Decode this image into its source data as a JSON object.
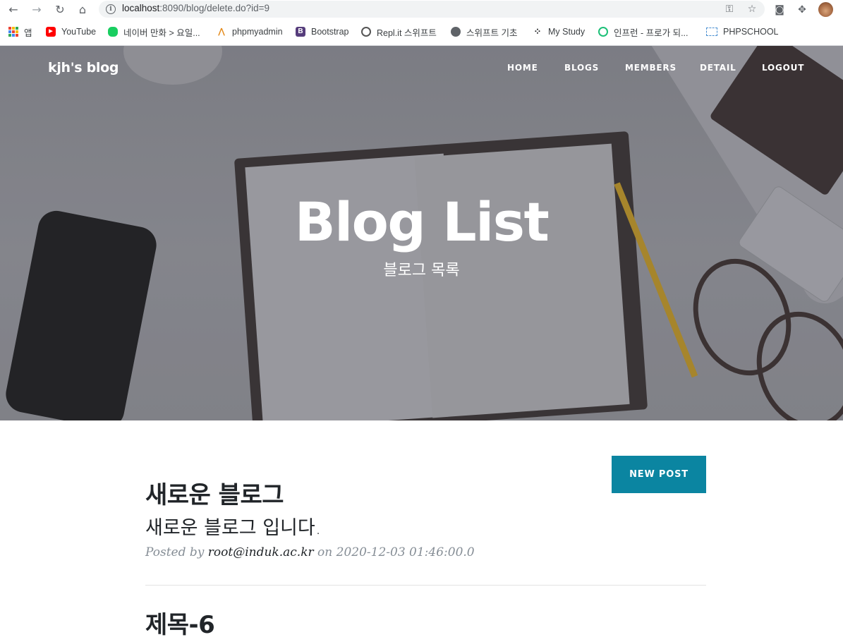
{
  "browser": {
    "url_host": "localhost",
    "url_rest": ":8090/blog/delete.do?id=9",
    "bookmarks": [
      {
        "label": "앱",
        "icon": "apps-grid-icon"
      },
      {
        "label": "YouTube",
        "icon": "youtube-icon"
      },
      {
        "label": "네이버 만화 > 요일...",
        "icon": "naver-webtoon-icon"
      },
      {
        "label": "phpmyadmin",
        "icon": "phpmyadmin-icon"
      },
      {
        "label": "Bootstrap",
        "icon": "bootstrap-icon"
      },
      {
        "label": "Repl.it 스위프트",
        "icon": "replit-icon"
      },
      {
        "label": "스위프트 기초",
        "icon": "globe-icon"
      },
      {
        "label": "My Study",
        "icon": "dots-icon"
      },
      {
        "label": "인프런 - 프로가 되...",
        "icon": "inflearn-icon"
      },
      {
        "label": "PHPSCHOOL",
        "icon": "phpschool-icon"
      }
    ]
  },
  "site": {
    "brand": "kjh's blog",
    "nav": [
      "HOME",
      "BLOGS",
      "MEMBERS",
      "DETAIL",
      "LOGOUT"
    ]
  },
  "hero": {
    "title": "Blog List",
    "subtitle": "블로그 목록"
  },
  "actions": {
    "new_post": "NEW POST"
  },
  "posts": [
    {
      "title": "새로운 블로그",
      "subtitle": "새로운 블로그 입니다.",
      "posted_by": "Posted by",
      "author": "root@induk.ac.kr",
      "on": "on",
      "date": "2020-12-03 01:46:00.0"
    },
    {
      "title": "제목-6"
    }
  ]
}
